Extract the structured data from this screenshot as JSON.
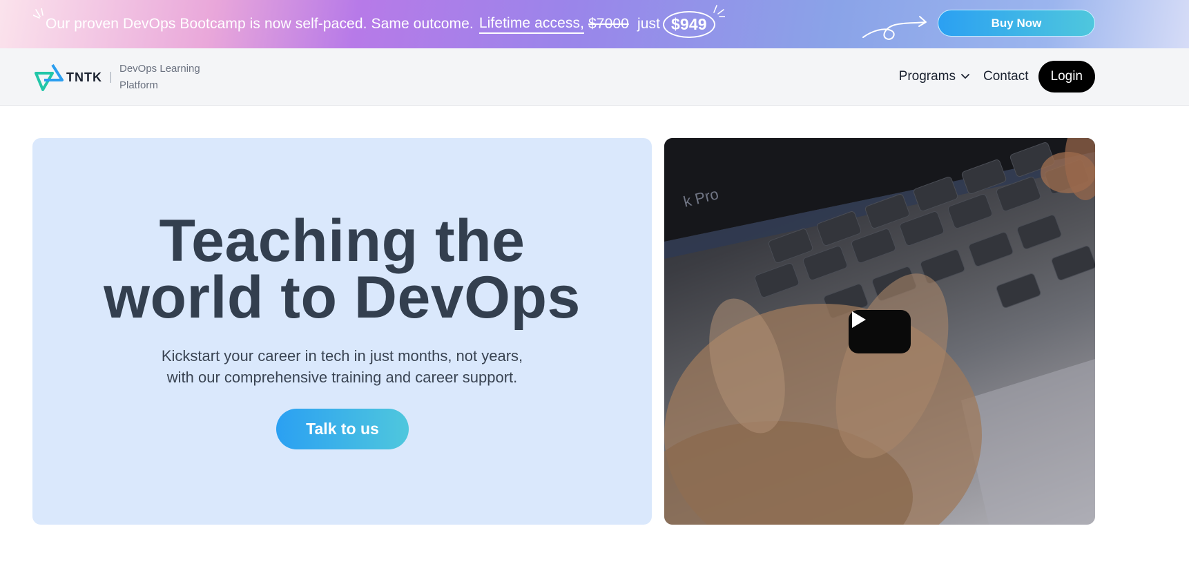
{
  "promo": {
    "text_main": "Our proven DevOps Bootcamp is now self-paced. Same outcome.",
    "text_underlined": "Lifetime access,",
    "old_price": "$7000",
    "connector": "just",
    "new_price": "$949",
    "buy_label": "Buy Now"
  },
  "header": {
    "logo_name": "TNTK",
    "logo_tagline_line1": "DevOps Learning",
    "logo_tagline_line2": "Platform",
    "nav": {
      "programs": "Programs",
      "contact": "Contact",
      "login": "Login"
    }
  },
  "hero": {
    "title_line1": "Teaching the",
    "title_line2": "world to DevOps",
    "subtitle_line1": "Kickstart your career in tech in just months, not years,",
    "subtitle_line2": "with our comprehensive training and career support.",
    "cta_label": "Talk to us"
  },
  "video": {
    "laptop_text": "k Pro"
  },
  "colors": {
    "accent_gradient_start": "#2ba0f2",
    "accent_gradient_end": "#4fc7dd",
    "hero_bg": "#dae8fc",
    "title_color": "#333f4f",
    "login_bg": "#000000"
  },
  "icons": [
    "sparkle-icon",
    "curly-arrow-icon",
    "tntk-logo-icon",
    "chevron-down-icon",
    "play-icon"
  ]
}
